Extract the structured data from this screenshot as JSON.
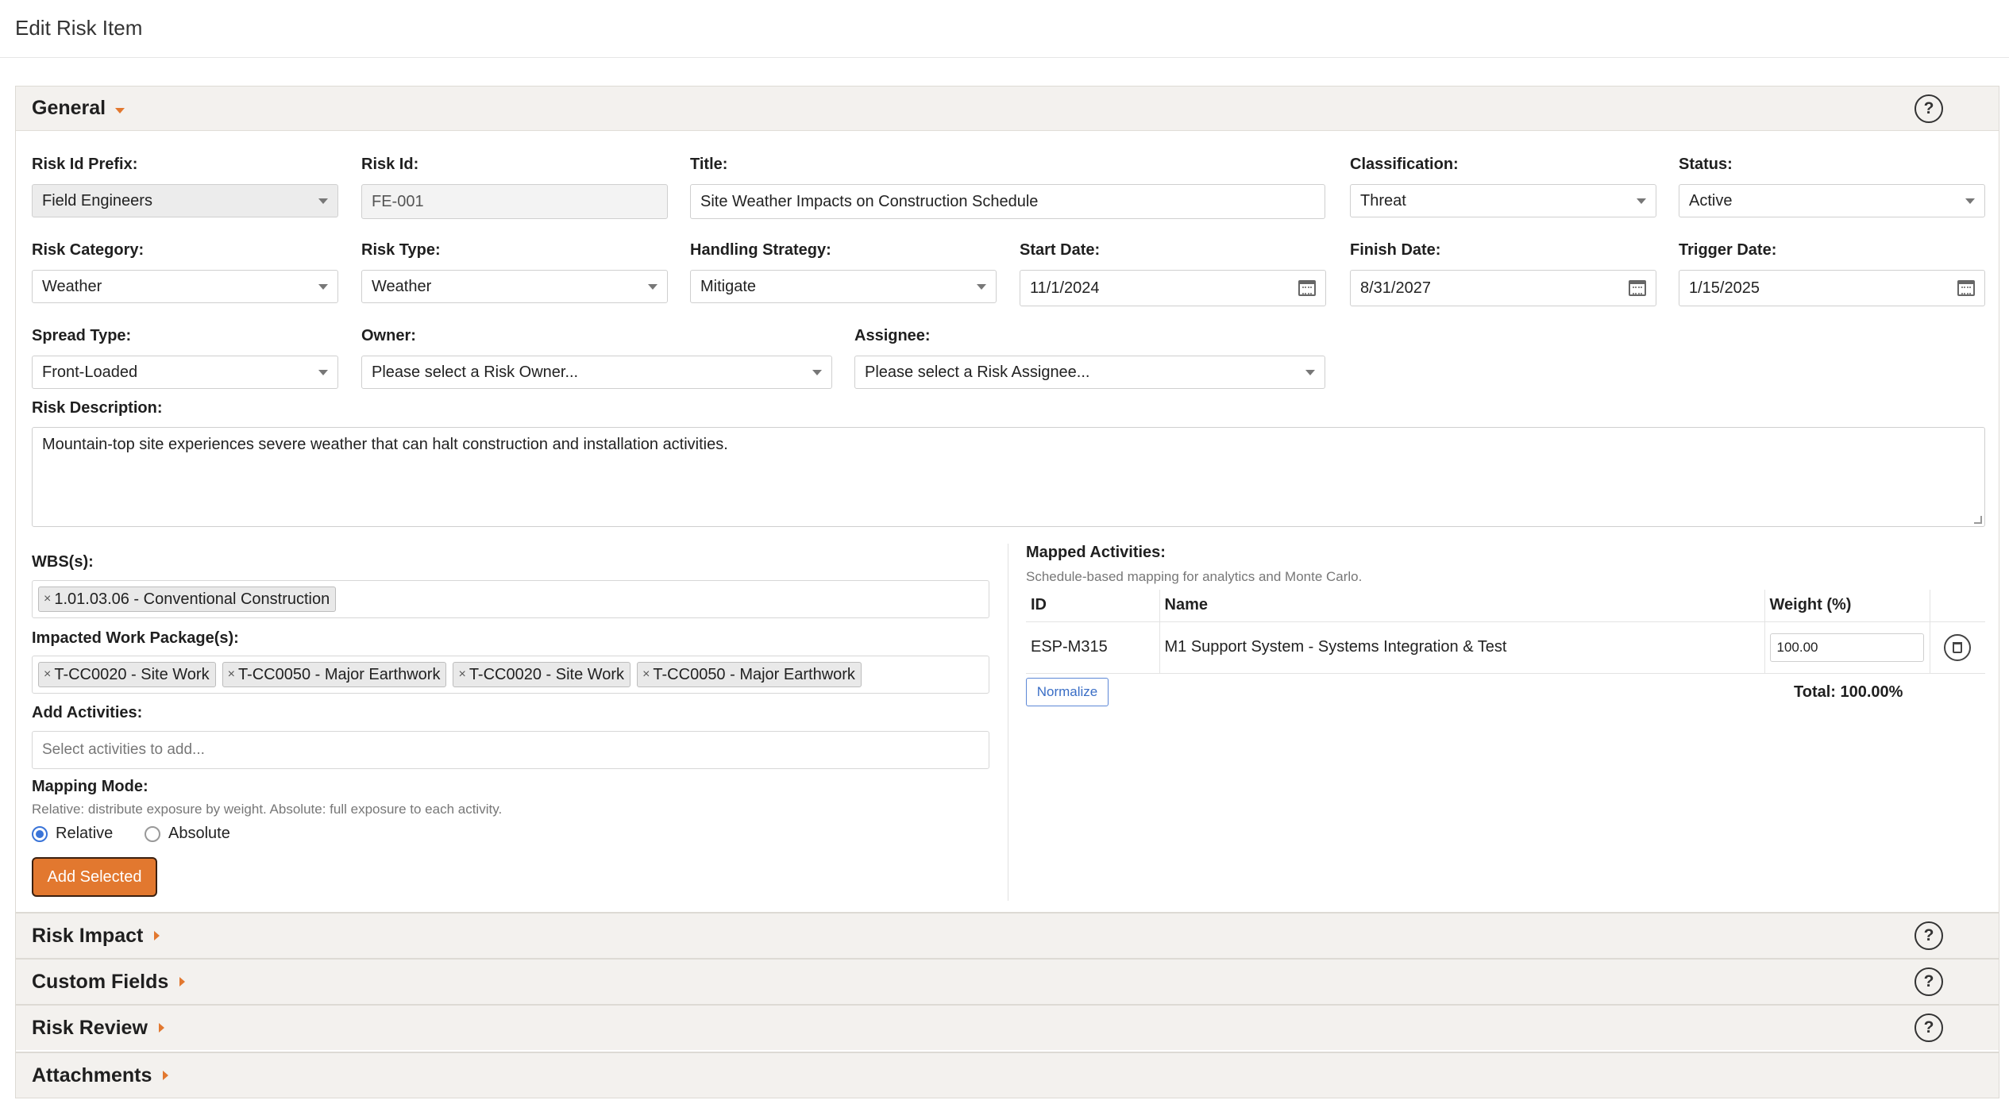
{
  "page": {
    "title": "Edit Risk Item"
  },
  "sections": {
    "general": "General",
    "risk_impact": "Risk Impact",
    "custom_fields": "Custom Fields",
    "risk_review": "Risk Review",
    "attachments": "Attachments",
    "help": "?"
  },
  "fields": {
    "risk_id_prefix": {
      "label": "Risk Id Prefix:",
      "value": "Field Engineers"
    },
    "risk_id": {
      "label": "Risk Id:",
      "value": "FE-001"
    },
    "title": {
      "label": "Title:",
      "value": "Site Weather Impacts on Construction Schedule"
    },
    "classification": {
      "label": "Classification:",
      "value": "Threat"
    },
    "status": {
      "label": "Status:",
      "value": "Active"
    },
    "risk_category": {
      "label": "Risk Category:",
      "value": "Weather"
    },
    "risk_type": {
      "label": "Risk Type:",
      "value": "Weather"
    },
    "handling_strategy": {
      "label": "Handling Strategy:",
      "value": "Mitigate"
    },
    "start_date": {
      "label": "Start Date:",
      "value": "11/1/2024"
    },
    "finish_date": {
      "label": "Finish Date:",
      "value": "8/31/2027"
    },
    "trigger_date": {
      "label": "Trigger Date:",
      "value": "1/15/2025"
    },
    "spread_type": {
      "label": "Spread Type:",
      "value": "Front-Loaded"
    },
    "owner": {
      "label": "Owner:",
      "value": "Please select a Risk Owner..."
    },
    "assignee": {
      "label": "Assignee:",
      "value": "Please select a Risk Assignee..."
    },
    "description": {
      "label": "Risk Description:",
      "value": "Mountain-top site experiences severe weather that can halt construction and installation activities."
    }
  },
  "wbs": {
    "label": "WBS(s):",
    "tags": [
      "1.01.03.06 - Conventional Construction"
    ]
  },
  "work_packages": {
    "label": "Impacted Work Package(s):",
    "tags": [
      "T-CC0020 - Site Work",
      "T-CC0050 - Major Earthwork",
      "T-CC0020 - Site Work",
      "T-CC0050 - Major Earthwork"
    ]
  },
  "tag_remove": "×",
  "add_activities": {
    "label": "Add Activities:",
    "placeholder": "Select activities to add..."
  },
  "mapping_mode": {
    "label": "Mapping Mode:",
    "hint": "Relative: distribute exposure by weight. Absolute: full exposure to each activity.",
    "options": [
      "Relative",
      "Absolute"
    ],
    "selected": "Relative"
  },
  "add_selected_button": "Add Selected",
  "mapped_activities": {
    "label": "Mapped Activities:",
    "hint": "Schedule-based mapping for analytics and Monte Carlo.",
    "columns": [
      "ID",
      "Name",
      "Weight (%)"
    ],
    "rows": [
      {
        "id": "ESP-M315",
        "name": "M1 Support System - Systems Integration & Test",
        "weight": "100.00"
      }
    ],
    "normalize_button": "Normalize",
    "total": "Total: 100.00%"
  },
  "colors": {
    "accent": "#e2782f",
    "link": "#3a6ec6",
    "radio": "#3a74d8"
  }
}
